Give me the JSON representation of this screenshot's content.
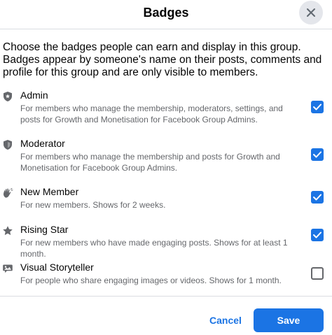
{
  "dialog": {
    "title": "Badges",
    "close_icon": "close-icon",
    "intro": "Choose the badges people can earn and display in this group. Badges appear by someone's name on their posts, comments and profile for this group and are only visible to members."
  },
  "badges": [
    {
      "icon": "shield-star-icon",
      "name": "Admin",
      "description": "For members who manage the membership, moderators, settings, and posts for Growth and Monetisation for Facebook Group Admins.",
      "checked": true
    },
    {
      "icon": "shield-icon",
      "name": "Moderator",
      "description": "For members who manage the membership and posts for Growth and Monetisation for Facebook Group Admins.",
      "checked": true
    },
    {
      "icon": "wave-hand-icon",
      "name": "New Member",
      "description": "For new members. Shows for 2 weeks.",
      "checked": true
    },
    {
      "icon": "star-icon",
      "name": "Rising Star",
      "description": "For new members who have made engaging posts. Shows for at least 1 month.",
      "checked": true
    },
    {
      "icon": "image-chat-icon",
      "name": "Visual Storyteller",
      "description": "For people who share engaging images or videos. Shows for 1 month.",
      "checked": false
    }
  ],
  "footer": {
    "cancel_label": "Cancel",
    "save_label": "Save"
  },
  "colors": {
    "accent": "#1b74e4",
    "secondary_text": "#65676b",
    "divider": "#dadde1"
  }
}
